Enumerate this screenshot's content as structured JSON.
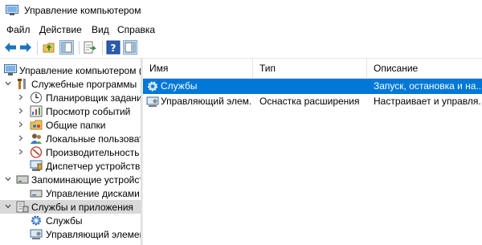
{
  "window": {
    "title": "Управление компьютером"
  },
  "menu": [
    {
      "label": "Файл"
    },
    {
      "label": "Действие"
    },
    {
      "label": "Вид"
    },
    {
      "label": "Справка"
    }
  ],
  "toolbar": {
    "buttons": [
      {
        "icon": "back-arrow-icon"
      },
      {
        "icon": "forward-arrow-icon"
      },
      {
        "icon": "up-folder-icon"
      },
      {
        "icon": "show-hide-tree-icon"
      },
      {
        "icon": "export-list-icon"
      },
      {
        "icon": "help-icon"
      },
      {
        "icon": "action-pane-icon"
      }
    ]
  },
  "tree": {
    "items": [
      {
        "label": "Управление компьютером (л",
        "icon": "computer-management-icon"
      },
      {
        "label": "Служебные программы",
        "icon": "tools-icon"
      },
      {
        "label": "Планировщик заданий",
        "icon": "task-scheduler-icon"
      },
      {
        "label": "Просмотр событий",
        "icon": "event-viewer-icon"
      },
      {
        "label": "Общие папки",
        "icon": "shared-folders-icon"
      },
      {
        "label": "Локальные пользовате",
        "icon": "local-users-icon"
      },
      {
        "label": "Производительность",
        "icon": "performance-icon"
      },
      {
        "label": "Диспетчер устройств",
        "icon": "device-manager-icon"
      },
      {
        "label": "Запоминающие устройст",
        "icon": "storage-icon"
      },
      {
        "label": "Управление дисками",
        "icon": "disk-management-icon"
      },
      {
        "label": "Службы и приложения",
        "icon": "services-apps-icon"
      },
      {
        "label": "Службы",
        "icon": "services-gear-icon"
      },
      {
        "label": "Управляющий элемен",
        "icon": "wmi-control-icon"
      }
    ]
  },
  "list": {
    "columns": [
      {
        "label": "Имя"
      },
      {
        "label": "Тип"
      },
      {
        "label": "Описание"
      }
    ],
    "rows": [
      {
        "name": "Службы",
        "type": "",
        "desc": "Запуск, остановка и на..."
      },
      {
        "name": "Управляющий элем...",
        "type": "Оснастка расширения",
        "desc": "Настраивает и управля..."
      }
    ]
  },
  "colors": {
    "selection": "#0078d7",
    "tree_selection": "#d9d9d9"
  }
}
